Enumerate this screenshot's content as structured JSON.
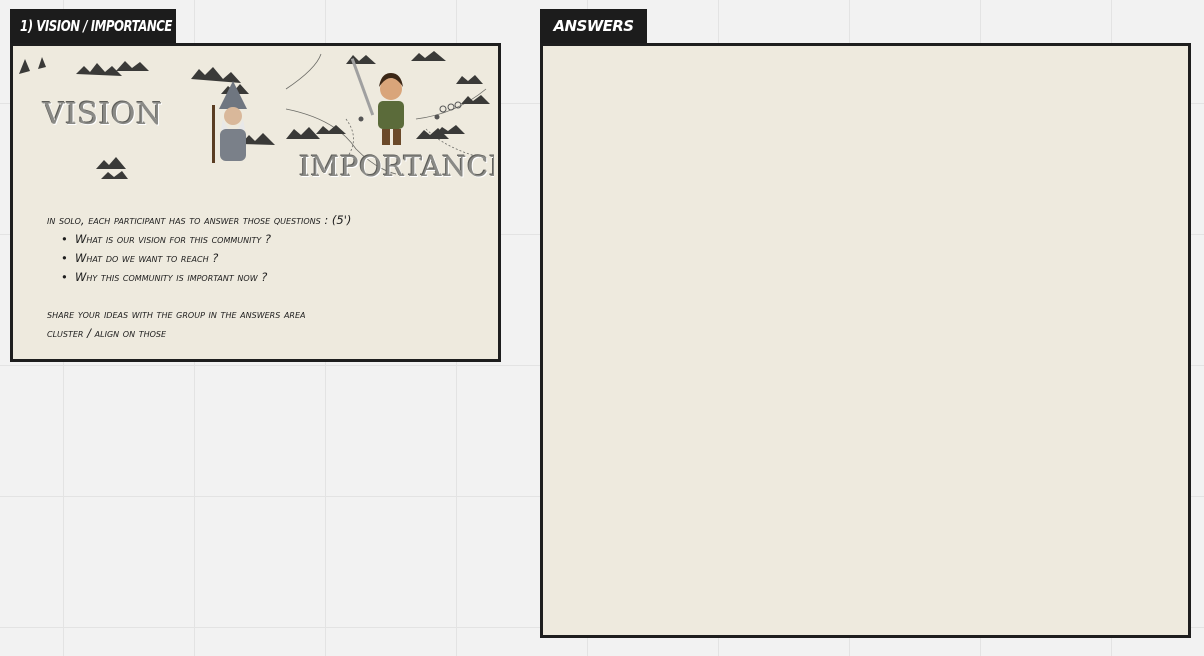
{
  "frames": {
    "vision": {
      "tab_label": "1) VISION / IMPORTANCE",
      "banner": {
        "word_left": "VISION",
        "word_right": "IMPORTANCE"
      },
      "instructions": {
        "intro": "in solo, each participant has to answer those questions : (5')",
        "questions": [
          "What is our vision for this community ?",
          "What do we want to reach ?",
          "Why this community is important now ?"
        ],
        "share": "share your ideas with the group in the answers area",
        "cluster": "cluster / align on those"
      }
    },
    "answers": {
      "tab_label": "ANSWERS"
    }
  },
  "colors": {
    "canvas": "#f2f2f2",
    "grid": "#e3e3e3",
    "frame_fill": "#eeeade",
    "frame_border": "#1e1e1e",
    "tab_fill": "#1c1c1c",
    "tab_text": "#ffffff"
  }
}
